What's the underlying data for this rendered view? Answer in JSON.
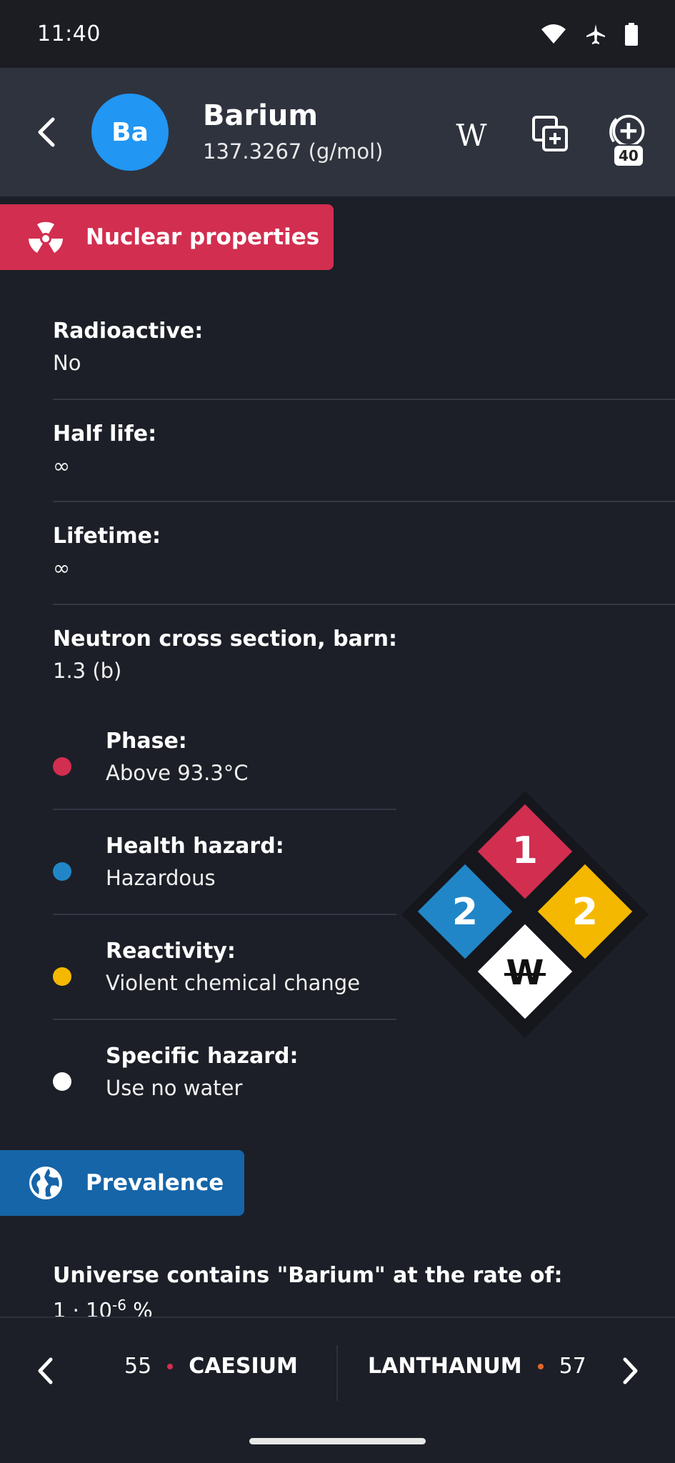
{
  "status_bar": {
    "time": "11:40"
  },
  "header": {
    "symbol": "Ba",
    "name": "Barium",
    "molar_mass": "137.3267 (g/mol)",
    "wiki_glyph": "W",
    "badge_count": "40",
    "avatar_color": "#2196f3"
  },
  "nuclear": {
    "title": "Nuclear properties",
    "color": "#d22e50",
    "props": [
      {
        "label": "Radioactive:",
        "value": "No"
      },
      {
        "label": "Half life:",
        "value": "∞"
      },
      {
        "label": "Lifetime:",
        "value": "∞"
      },
      {
        "label": "Neutron cross section, barn:",
        "value": "1.3 (b)"
      }
    ]
  },
  "hazards": [
    {
      "label": "Phase:",
      "value": "Above 93.3°C",
      "color": "#d22e50"
    },
    {
      "label": "Health hazard:",
      "value": "Hazardous",
      "color": "#2186c8"
    },
    {
      "label": "Reactivity:",
      "value": "Violent chemical change",
      "color": "#f5b800"
    },
    {
      "label": "Specific hazard:",
      "value": "Use no water",
      "color": "#ffffff"
    }
  ],
  "nfpa_diamond": {
    "flammability": "1",
    "health": "2",
    "reactivity": "2",
    "special": "W"
  },
  "prevalence": {
    "title": "Prevalence",
    "color": "#1565a8",
    "universe_label": "Universe contains \"Barium\" at the rate of:",
    "universe_value_base": "1 · 10",
    "universe_value_exp": "-6",
    "universe_value_unit": " %"
  },
  "bottom_nav": {
    "prev_number": "55",
    "prev_name": "CAESIUM",
    "prev_dot_color": "#d22e50",
    "next_name": "LANTHANUM",
    "next_number": "57",
    "next_dot_color": "#e0662a"
  }
}
